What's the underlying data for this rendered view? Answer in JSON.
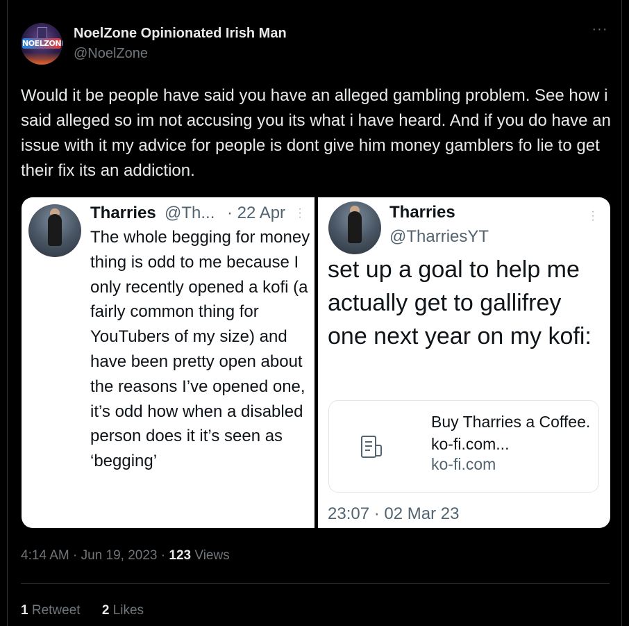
{
  "author": {
    "display_name": "NoelZone Opinionated Irish Man",
    "handle": "@NoelZone",
    "avatar_label": "NOELZONE"
  },
  "tweet": {
    "text": "Would it be people have said you have an alleged gambling problem. See how i said alleged so im not accusing you its what i have heard. And if you do have an issue with it my advice for people is dont give him money gamblers fo lie to get their fix its an addiction.",
    "time": "4:14 AM",
    "date": "Jun 19, 2023",
    "views_count": "123",
    "views_label": "Views",
    "retweets_count": "1",
    "retweets_label": "Retweet",
    "likes_count": "2",
    "likes_label": "Likes"
  },
  "quote_left": {
    "name": "Tharries",
    "handle": "@Th...",
    "date": "· 22 Apr",
    "text": "The whole begging for money thing is odd to me because I only recently opened a kofi (a fairly common thing for YouTubers of my size) and have been pretty open about the reasons I’ve opened one, it’s odd how when a disabled person does it  it’s seen as ‘begging’"
  },
  "quote_right": {
    "name": "Tharries",
    "handle": "@TharriesYT",
    "text": "set up a goal to help me actually get to gallifrey one next year on my kofi:",
    "link_title": "Buy Tharries a Coffee. ko-fi.com...",
    "link_domain": "ko-fi.com",
    "timestamp": "23:07 · 02 Mar 23"
  },
  "icons": {
    "more": "more-horizontal-icon",
    "link": "document-icon"
  },
  "colors": {
    "background": "#000000",
    "text_primary": "#e7e9ea",
    "text_secondary": "#71767b",
    "quote_bg": "#ffffff"
  }
}
